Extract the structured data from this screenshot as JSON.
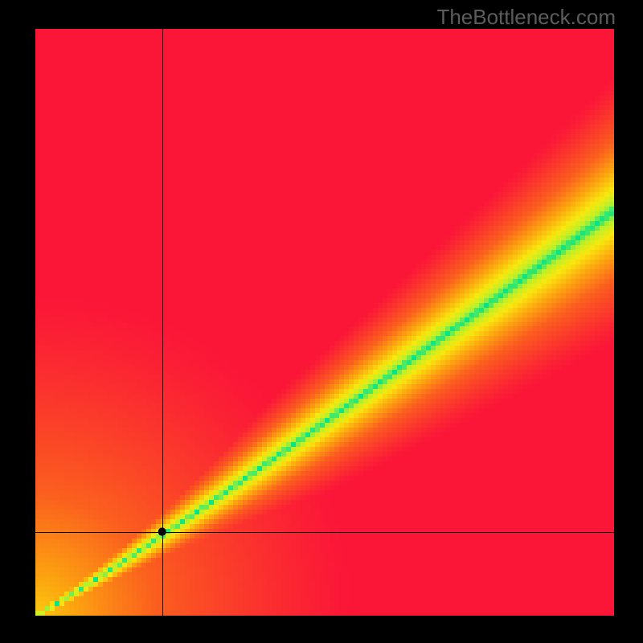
{
  "watermark": "TheBottleneck.com",
  "chart_data": {
    "type": "heatmap",
    "title": "",
    "xlabel": "",
    "ylabel": "",
    "xlim": [
      0,
      1
    ],
    "ylim": [
      0,
      1
    ],
    "pixel_grid": {
      "cols": 120,
      "rows": 122
    },
    "crosshair": {
      "x": 0.219,
      "y": 0.143
    },
    "marker": {
      "x": 0.219,
      "y": 0.143
    },
    "green_band": {
      "description": "Green diagonal band where y ≈ 0.69*x^1.07, widening with x",
      "center_fn": "0.69*pow(x,1.07)",
      "halfwidth_fn": "0.006 + 0.065*x"
    },
    "colorscale": {
      "description": "Distance from band center normalized by local width maps through red→orange→yellow→green",
      "stops": [
        {
          "t": 0.0,
          "color": "#fb1638"
        },
        {
          "t": 0.4,
          "color": "#fb5f1e"
        },
        {
          "t": 0.62,
          "color": "#fca60f"
        },
        {
          "t": 0.8,
          "color": "#f8e80e"
        },
        {
          "t": 0.92,
          "color": "#b8f02a"
        },
        {
          "t": 1.0,
          "color": "#00e48a"
        }
      ]
    }
  }
}
